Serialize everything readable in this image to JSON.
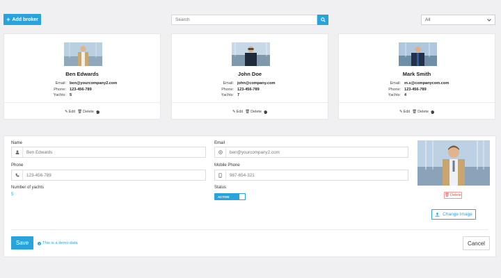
{
  "toolbar": {
    "add_label": "Add broker",
    "search_placeholder": "Search",
    "filter_value": "All"
  },
  "brokers": [
    {
      "name": "Ben Edwards",
      "email_label": "Email:",
      "email": "ben@yourcompany2.com",
      "phone_label": "Phone:",
      "phone": "123-456-789",
      "yachts_label": "Yachts:",
      "yachts": "5"
    },
    {
      "name": "John Doe",
      "email_label": "Email:",
      "email": "john@company.com",
      "phone_label": "Phone:",
      "phone": "123-456-789",
      "yachts_label": "Yachts:",
      "yachts": "7"
    },
    {
      "name": "Mark Smith",
      "email_label": "Email:",
      "email": "m.s@companycom.com",
      "phone_label": "Phone:",
      "phone": "123-456-789",
      "yachts_label": "Yachts:",
      "yachts": "4"
    }
  ],
  "card_actions": {
    "edit": "Edit",
    "delete": "Delete"
  },
  "form": {
    "name_label": "Name",
    "name_value": "Ben Edwards",
    "email_label": "Email",
    "email_value": "ben@yourcompany2.com",
    "phone_label": "Phone",
    "phone_value": "123-456-789",
    "mobile_label": "Mobile Phone",
    "mobile_value": "987-654-321",
    "yachts_label": "Number of yachts",
    "yachts_value": "5",
    "status_label": "Status",
    "status_value": "ACTIVE",
    "delete_label": "Delete",
    "change_image_label": "Change Image",
    "save_label": "Save",
    "demo_note": "This is a demo data",
    "cancel_label": "Cancel"
  },
  "colors": {
    "accent": "#29a3dc",
    "danger": "#d9534f"
  }
}
